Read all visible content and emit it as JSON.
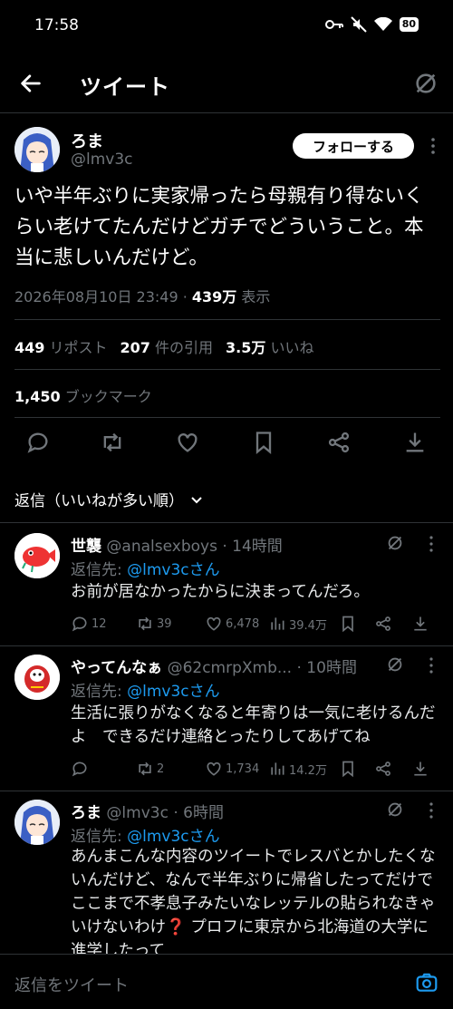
{
  "status_bar": {
    "time": "17:58",
    "battery": "80"
  },
  "header": {
    "title": "ツイート"
  },
  "tweet": {
    "author_name": "ろま",
    "author_handle": "@lmv3c",
    "follow_label": "フォローする",
    "text": "いや半年ぶりに実家帰ったら母親有り得ないくらい老けてたんだけどガチでどういうこと。本当に悲しいんだけど。",
    "timestamp": "2026年08月10日 23:49",
    "views_count": "439万",
    "views_label": "表示",
    "reposts_count": "449",
    "reposts_label": "リポスト",
    "quotes_count": "207",
    "quotes_label": "件の引用",
    "likes_count": "3.5万",
    "likes_label": "いいね",
    "bookmarks_count": "1,450",
    "bookmarks_label": "ブックマーク"
  },
  "sort_label": "返信（いいねが多い順）",
  "replies": [
    {
      "name": "世襲",
      "handle": "@analsexboys",
      "time": "· 14時間",
      "reply_prefix": "返信先: ",
      "reply_to": "@lmv3cさん",
      "text": "お前が居なかったからに決まってんだろ。",
      "comments": "12",
      "retweets": "39",
      "likes": "6,478",
      "views": "39.4万"
    },
    {
      "name": "やってんなぁ",
      "handle": "@62cmrpXmb...",
      "time": "· 10時間",
      "reply_prefix": "返信先: ",
      "reply_to": "@lmv3cさん",
      "text": "生活に張りがなくなると年寄りは一気に老けるんだよ　できるだけ連絡とったりしてあげてね",
      "comments": "",
      "retweets": "2",
      "likes": "1,734",
      "views": "14.2万"
    },
    {
      "name": "ろま",
      "handle": "@lmv3c",
      "time": "· 6時間",
      "reply_prefix": "返信先: ",
      "reply_to": "@lmv3cさん",
      "text": "あんまこんな内容のツイートでレスバとかしたくないんだけど、なんで半年ぶりに帰省したってだけでここまで不孝息子みたいなレッテルの貼られなきゃいけないわけ❓ プロフに東京から北海道の大学に進学したって"
    }
  ],
  "compose": {
    "placeholder": "返信をツイート"
  },
  "colors": {
    "accent": "#1d9bf0",
    "background": "#000000",
    "muted": "#71767b",
    "divider": "#2f3336"
  }
}
